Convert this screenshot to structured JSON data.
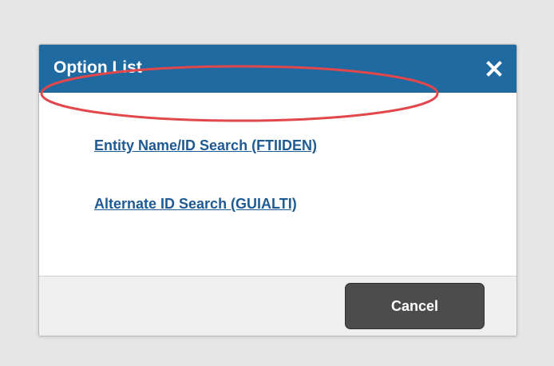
{
  "dialog": {
    "title": "Option List",
    "close_icon": "close-icon",
    "options": [
      {
        "label": "Entity Name/ID Search (FTIIDEN)",
        "highlighted": true
      },
      {
        "label": "Alternate ID Search (GUIALTI)",
        "highlighted": false
      }
    ],
    "cancel_label": "Cancel"
  },
  "colors": {
    "backdrop": "#e6e6e6",
    "header": "#1f6aa0",
    "link": "#1f5a93",
    "highlight": "#e2474c",
    "button": "#4c4c4c",
    "footer": "#efefef"
  }
}
